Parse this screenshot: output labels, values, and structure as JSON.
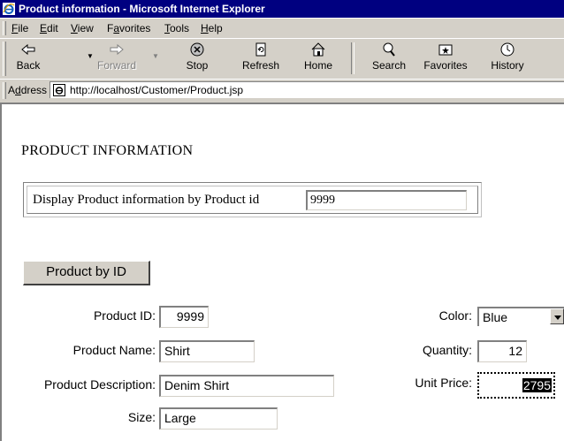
{
  "window": {
    "title": "Product information - Microsoft Internet Explorer"
  },
  "menu": [
    {
      "label": "File"
    },
    {
      "label": "Edit"
    },
    {
      "label": "View"
    },
    {
      "label": "Favorites"
    },
    {
      "label": "Tools"
    },
    {
      "label": "Help"
    }
  ],
  "toolbar": {
    "back": "Back",
    "forward": "Forward",
    "stop": "Stop",
    "refresh": "Refresh",
    "home": "Home",
    "search": "Search",
    "favorites": "Favorites",
    "history": "History"
  },
  "address": {
    "label": "Address",
    "url": "http://localhost/Customer/Product.jsp"
  },
  "page": {
    "heading": "PRODUCT INFORMATION",
    "search_label": "Display Product information by Product id",
    "search_value": "9999",
    "button": "Product by ID"
  },
  "form": {
    "product_id_label": "Product ID:",
    "product_id": "9999",
    "product_name_label": "Product Name:",
    "product_name": "Shirt",
    "product_description_label": "Product Description:",
    "product_description": "Denim Shirt",
    "size_label": "Size:",
    "size": "Large",
    "color_label": "Color:",
    "color": "Blue",
    "quantity_label": "Quantity:",
    "quantity": "12",
    "unit_price_label": "Unit Price:",
    "unit_price": "2795"
  }
}
